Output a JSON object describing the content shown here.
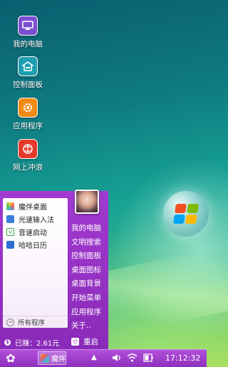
{
  "desktop": {
    "icons": [
      {
        "label": "我的电脑",
        "icon": "computer-icon",
        "color": "#7b4fd0"
      },
      {
        "label": "控制面板",
        "icon": "control-panel-icon",
        "color": "#1f9fae"
      },
      {
        "label": "应用程序",
        "icon": "applications-gear-icon",
        "color": "#f08a14"
      },
      {
        "label": "网上冲浪",
        "icon": "browser-globe-icon",
        "color": "#e53a2a"
      }
    ]
  },
  "start_menu": {
    "apps": [
      {
        "label": "魔伴桌面",
        "icon": "moban-desktop-icon",
        "color": "#e58a2a"
      },
      {
        "label": "光速输入法",
        "icon": "input-method-icon",
        "color": "#3a7fd8"
      },
      {
        "label": "音速启动",
        "icon": "quick-launch-icon",
        "color": "#3aa84a"
      },
      {
        "label": "哈哈日历",
        "icon": "calendar-icon",
        "color": "#2a6fd0"
      }
    ],
    "all_programs": "所有程序",
    "right_items": [
      "我的电脑",
      "文明搜索",
      "控制面板",
      "桌面图标",
      "桌面背景",
      "开始菜单",
      "应用程序",
      "关于.."
    ],
    "earned": "已赚：2.61元",
    "restart": "重启"
  },
  "taskbar": {
    "start_icon": "start-flower-icon",
    "task_label": "魔伴",
    "clock": "17:12:32"
  }
}
